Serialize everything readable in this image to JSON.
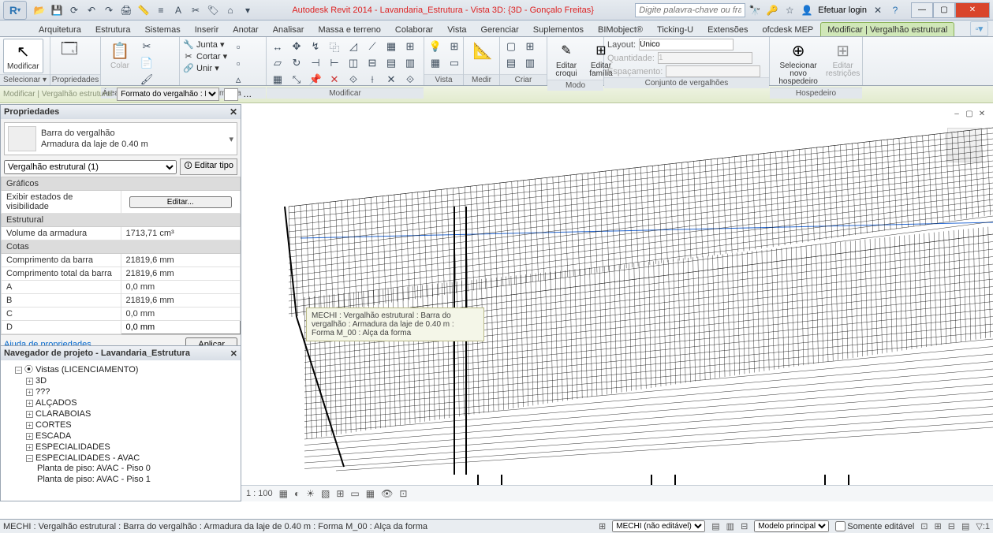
{
  "titlebar": {
    "title_prefix": "Autodesk Revit 2014 - ",
    "title_doc": "Lavandaria_Estrutura - Vista 3D: {3D - Gonçalo Freitas}",
    "search_placeholder": "Digite palavra-chave ou frase",
    "login": "Efetuar login"
  },
  "tabs": {
    "items": [
      "Arquitetura",
      "Estrutura",
      "Sistemas",
      "Inserir",
      "Anotar",
      "Analisar",
      "Massa e terreno",
      "Colaborar",
      "Vista",
      "Gerenciar",
      "Suplementos",
      "BIMobject®",
      "Ticking-U",
      "Extensões",
      "ofcdesk MEP",
      "Modificar | Vergalhão estrutural"
    ],
    "active_index": 15
  },
  "ribbon": {
    "selecionar": {
      "label": "Selecionar ▾",
      "big": "Modificar"
    },
    "propriedades": {
      "label": "Propriedades",
      "big": "Propriedades"
    },
    "clipboard": {
      "label": "Área de transferência",
      "paste": "Colar"
    },
    "geom": {
      "label": "Geometria",
      "junta": "Junta ▾",
      "cortar": "Cortar ▾",
      "unir": "Unir ▾"
    },
    "modificar": {
      "label": "Modificar"
    },
    "vista": {
      "label": "Vista"
    },
    "medir": {
      "label": "Medir"
    },
    "criar": {
      "label": "Criar"
    },
    "modo": {
      "label": "Modo",
      "croqui": "Editar croqui",
      "familia": "Editar família"
    },
    "conjunto": {
      "label": "Conjunto de vergalhões",
      "layout": "Layout:",
      "layout_val": "Único",
      "qtd": "Quantidade:",
      "qtd_val": "1",
      "esp": "Espaçamento:"
    },
    "hospedeiro": {
      "label": "Hospedeiro",
      "novo": "Selecionar novo hospedeiro",
      "restr": "Editar restrições"
    }
  },
  "options": {
    "context": "Modificar | Vergalhão estrutural",
    "format_label": "Formato do vergalhão : M ▾"
  },
  "palette": {
    "title": "Propriedades",
    "type_line1": "Barra do vergalhão",
    "type_line2": "Armadura da laje de 0.40 m",
    "instance": "Vergalhão estrutural (1)",
    "edit_type": "Editar tipo",
    "cat_graficos": "Gráficos",
    "row_visib": "Exibir estados de visibilidade",
    "row_visib_btn": "Editar...",
    "cat_estrutural": "Estrutural",
    "row_vol": "Volume da armadura",
    "row_vol_v": "1713,71 cm³",
    "cat_cotas": "Cotas",
    "row_comp": "Comprimento da barra",
    "row_comp_v": "21819,6 mm",
    "row_comptot": "Comprimento total da barra",
    "row_comptot_v": "21819,6 mm",
    "rowA": "A",
    "rowA_v": "0,0 mm",
    "rowB": "B",
    "rowB_v": "21819,6 mm",
    "rowC": "C",
    "rowC_v": "0,0 mm",
    "rowD": "D",
    "rowD_v": "0,0 mm",
    "help": "Ajuda de propriedades",
    "apply": "Aplicar"
  },
  "browser": {
    "title": "Navegador de projeto - Lavandaria_Estrutura",
    "root": "Vistas (LICENCIAMENTO)",
    "items": [
      "3D",
      "???",
      "ALÇADOS",
      "CLARABOIAS",
      "CORTES",
      "ESCADA",
      "ESPECIALIDADES",
      "ESPECIALIDADES - AVAC"
    ],
    "subitems": [
      "Planta de piso: AVAC - Piso 0",
      "Planta de piso: AVAC - Piso 1"
    ]
  },
  "tooltip": "MECHI : Vergalhão estrutural : Barra do vergalhão : Armadura da laje de 0.40 m : Forma M_00 : Alça da forma",
  "viewbar": {
    "scale": "1 : 100"
  },
  "status": {
    "text": "MECHI : Vergalhão estrutural : Barra do vergalhão : Armadura da laje de 0.40 m : Forma M_00 : Alça da forma",
    "ws": "MECHI (não editável)",
    "design": "Modelo principal",
    "editonly": "Somente editável"
  }
}
